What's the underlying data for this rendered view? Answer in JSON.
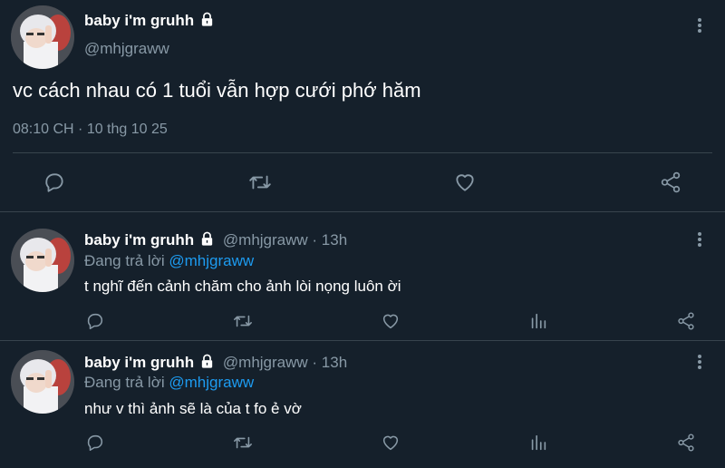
{
  "main_tweet": {
    "display_name": "baby i'm gruhh",
    "handle": "@mhjgraww",
    "text": "vc cách nhau có 1 tuổi vẫn hợp cưới phớ hăm",
    "timestamp": "08:10 CH · 10 thg 10 25"
  },
  "replies": [
    {
      "display_name": "baby i'm gruhh",
      "handle_time": "@mhjgraww · 13h",
      "replying_prefix": "Đang trả lời ",
      "replying_to": "@mhjgraww",
      "text": "t nghĩ đến cảnh chăm cho ảnh lòi nọng luôn ời"
    },
    {
      "display_name": "baby i'm gruhh",
      "handle_time": "@mhjgraww · 13h",
      "replying_prefix": "Đang trả lời ",
      "replying_to": "@mhjgraww",
      "text": "như v thì ảnh sẽ là của t fo ẻ vờ"
    }
  ],
  "icons": {
    "reply": "reply-bubble-icon",
    "retweet": "retweet-icon",
    "like": "heart-icon",
    "views": "analytics-bars-icon",
    "share": "share-icon",
    "more": "more-vertical-icon",
    "lock": "lock-icon"
  },
  "colors": {
    "background": "#15202b",
    "divider": "#38444d",
    "muted_text": "#8899a6",
    "link": "#1d9bf0"
  }
}
